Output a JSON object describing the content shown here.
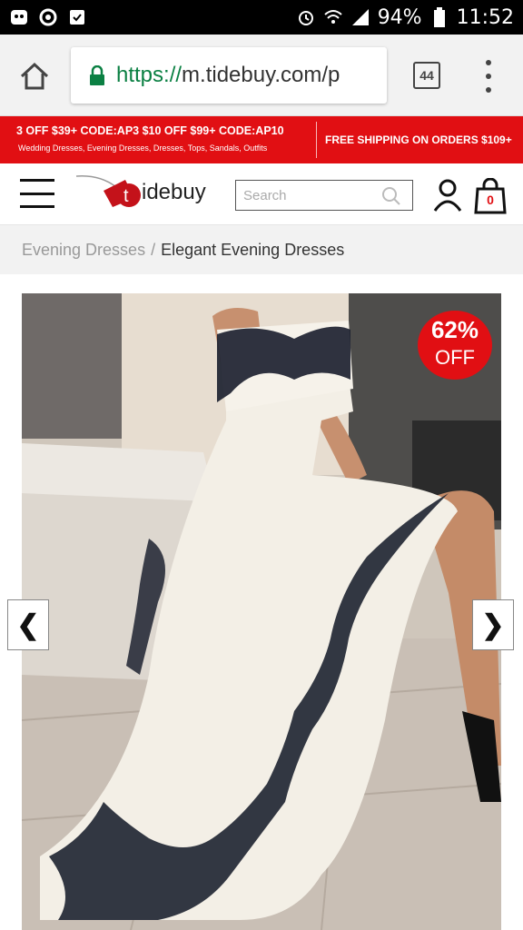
{
  "status_bar": {
    "battery": "94%",
    "time": "11:52",
    "icons": [
      "notification-icon",
      "sync-icon",
      "clipboard-icon",
      "alarm-icon",
      "wifi-icon",
      "signal-icon",
      "battery-icon"
    ]
  },
  "browser": {
    "url_scheme": "https://",
    "url_rest": "m.tidebuy.com/p",
    "tab_count": "44",
    "icons": [
      "home-icon",
      "lock-icon",
      "overflow-menu-icon"
    ]
  },
  "promo": {
    "codes": "3 OFF $39+ CODE:AP3   $10 OFF $99+ CODE:AP10",
    "categories": "Wedding  Dresses,  Evening Dresses, Dresses, Tops, Sandals, Outfits",
    "shipping": "FREE SHIPPING ON ORDERS $109+",
    "color": "#e10f13"
  },
  "header": {
    "logo_text": "idebuy",
    "logo_letter": "t",
    "search_placeholder": "Search",
    "cart_count": "0"
  },
  "breadcrumb": {
    "parent": "Evening Dresses",
    "separator": "/",
    "current": "Elegant Evening Dresses"
  },
  "product": {
    "discount_percent": "62%",
    "discount_label": "OFF",
    "prev_arrow": "❮",
    "next_arrow": "❯"
  }
}
